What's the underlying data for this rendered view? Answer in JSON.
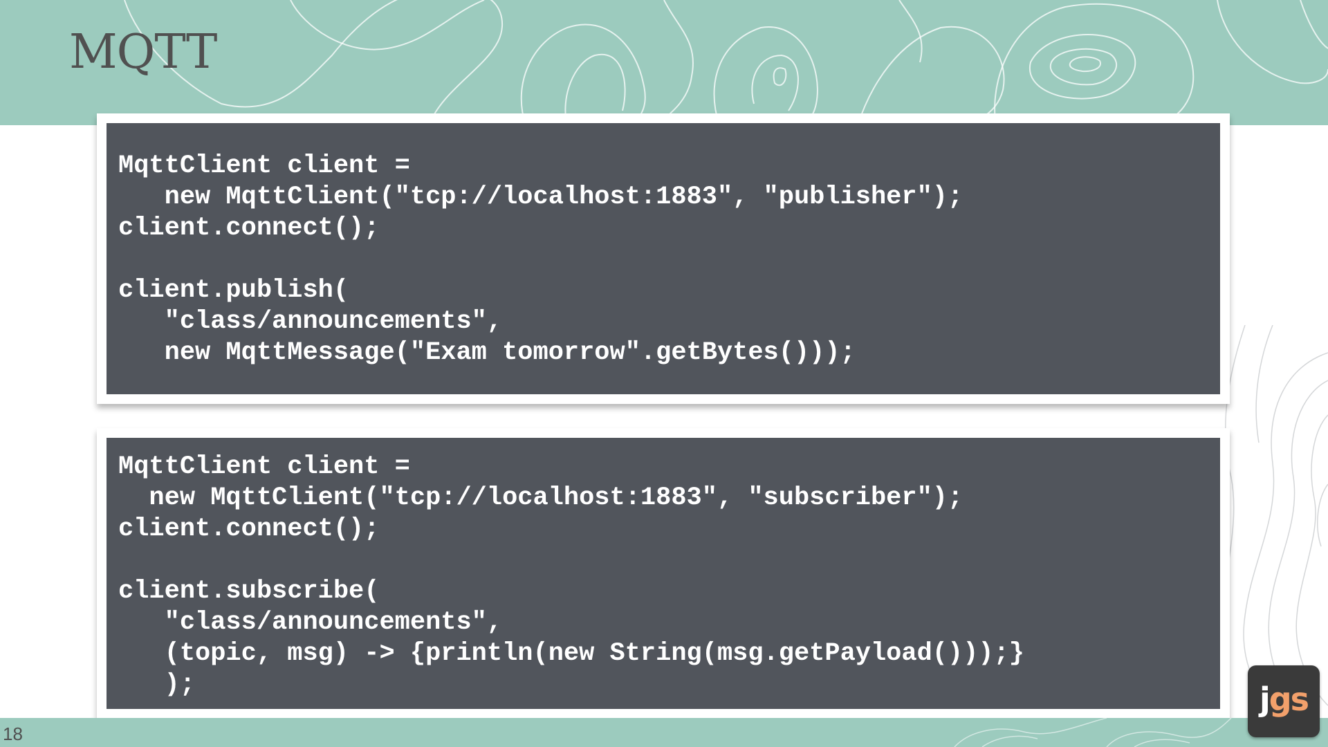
{
  "slide": {
    "title": "MQTT",
    "page_number": "18"
  },
  "publisher_code": {
    "lines": [
      "MqttClient client =",
      "   new MqttClient(\"tcp://localhost:1883\", \"publisher\");",
      "client.connect();",
      "",
      "client.publish(",
      "   \"class/announcements\",",
      "   new MqttMessage(\"Exam tomorrow\".getBytes()));"
    ]
  },
  "subscriber_code": {
    "lines": [
      "MqttClient client =",
      "  new MqttClient(\"tcp://localhost:1883\", \"subscriber\");",
      "client.connect();",
      "",
      "client.subscribe(",
      "   \"class/announcements\",",
      "   (topic, msg) -> {println(new String(msg.getPayload()));}",
      "   );"
    ]
  },
  "logo": {
    "j": "j",
    "gs": "gs",
    "icon": "jgs-logo-icon"
  },
  "colors": {
    "band": "#9ccbbe",
    "code_bg": "#51555c",
    "title": "#505050",
    "logo_accent": "#f2a06b"
  }
}
